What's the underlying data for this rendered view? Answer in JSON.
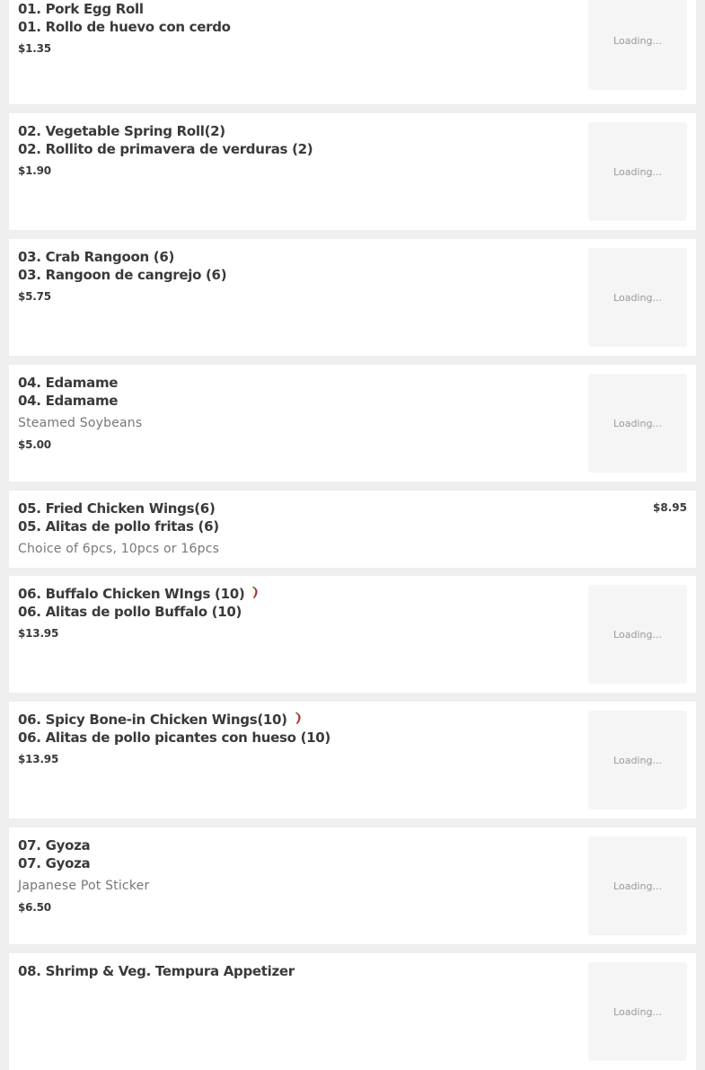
{
  "loading_label": "Loading...",
  "items": [
    {
      "name": "01. Pork Egg Roll",
      "name_es": "01. Rollo de huevo con cerdo",
      "desc": "",
      "price": "$1.35",
      "spicy": false,
      "has_image": true
    },
    {
      "name": "02. Vegetable Spring Roll(2)",
      "name_es": "02. Rollito de primavera de verduras (2)",
      "desc": "",
      "price": "$1.90",
      "spicy": false,
      "has_image": true
    },
    {
      "name": "03. Crab Rangoon (6)",
      "name_es": "03. Rangoon de cangrejo (6)",
      "desc": "",
      "price": "$5.75",
      "spicy": false,
      "has_image": true
    },
    {
      "name": "04. Edamame",
      "name_es": "04. Edamame",
      "desc": "Steamed Soybeans",
      "price": "$5.00",
      "spicy": false,
      "has_image": true
    },
    {
      "name": "05. Fried Chicken Wings(6)",
      "name_es": "05. Alitas de pollo fritas (6)",
      "desc": "Choice of 6pcs, 10pcs or 16pcs",
      "price": "$8.95",
      "spicy": false,
      "has_image": false
    },
    {
      "name": "06. Buffalo Chicken WIngs (10)",
      "name_es": "06. Alitas de pollo Buffalo (10)",
      "desc": "",
      "price": "$13.95",
      "spicy": true,
      "has_image": true
    },
    {
      "name": "06. Spicy Bone-in Chicken Wings(10)",
      "name_es": "06. Alitas de pollo picantes con hueso (10)",
      "desc": "",
      "price": "$13.95",
      "spicy": true,
      "has_image": true
    },
    {
      "name": "07. Gyoza",
      "name_es": "07. Gyoza",
      "desc": "Japanese Pot Sticker",
      "price": "$6.50",
      "spicy": false,
      "has_image": true
    },
    {
      "name": "08. Shrimp & Veg. Tempura Appetizer",
      "name_es": "",
      "desc": "",
      "price": "",
      "spicy": false,
      "has_image": true
    }
  ]
}
